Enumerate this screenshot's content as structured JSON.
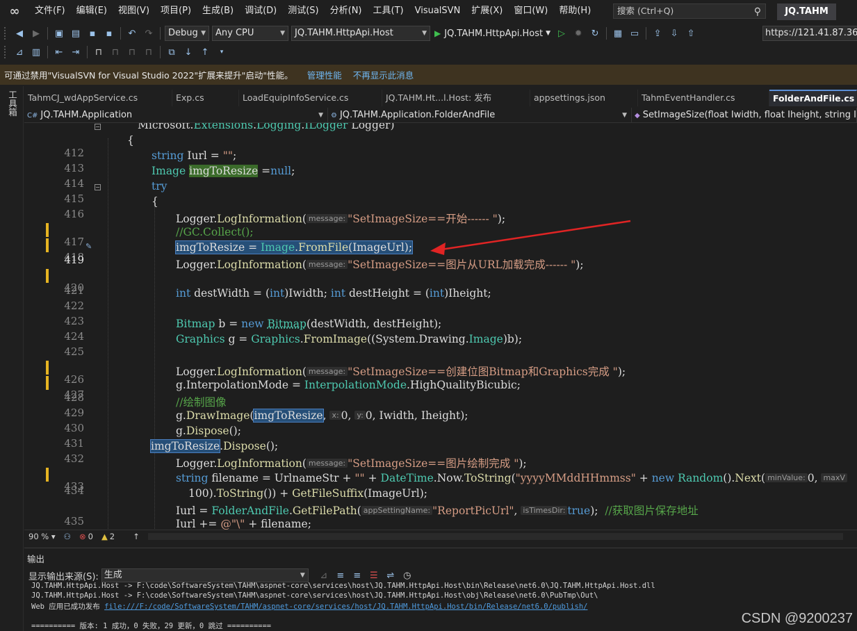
{
  "menu": {
    "items": [
      "文件(F)",
      "编辑(E)",
      "视图(V)",
      "项目(P)",
      "生成(B)",
      "调试(D)",
      "测试(S)",
      "分析(N)",
      "工具(T)",
      "VisualSVN",
      "扩展(X)",
      "窗口(W)",
      "帮助(H)"
    ],
    "search_placeholder": "搜索 (Ctrl+Q)",
    "solution_name": "JQ.TAHM"
  },
  "toolbar": {
    "configuration": "Debug",
    "platform": "Any CPU",
    "startup_project": "JQ.TAHM.HttpApi.Host",
    "run_target": "JQ.TAHM.HttpApi.Host",
    "url": "https://121.41.87.36/"
  },
  "infobar": {
    "message": "可通过禁用\"VisualSVN for Visual Studio 2022\"扩展来提升\"启动\"性能。",
    "link_manage": "管理性能",
    "link_dismiss": "不再显示此消息"
  },
  "left_strip": {
    "toolbox_label": "工具箱"
  },
  "tabs": [
    {
      "label": "TahmCJ_wdAppService.cs",
      "active": false
    },
    {
      "label": "Exp.cs",
      "active": false
    },
    {
      "label": "LoadEquipInfoService.cs",
      "active": false
    },
    {
      "label": "JQ.TAHM.Ht...l.Host: 发布",
      "active": false
    },
    {
      "label": "appsettings.json",
      "active": false
    },
    {
      "label": "TahmEventHandler.cs",
      "active": false
    },
    {
      "label": "FolderAndFile.cs",
      "active": true
    }
  ],
  "navbar": {
    "project": "JQ.TAHM.Application",
    "class": "JQ.TAHM.Application.FolderAndFile",
    "member": "SetImageSize(float Iwidth, float Iheight, string ImageUrl"
  },
  "editor": {
    "line_numbers": [
      "412",
      "413",
      "414",
      "415",
      "416",
      "417",
      "418",
      "419",
      "420",
      "421",
      "422",
      "423",
      "424",
      "425",
      "426",
      "427",
      "428",
      "429",
      "430",
      "431",
      "432",
      "433",
      "434",
      "",
      "435",
      "436"
    ],
    "current_line": "419",
    "hints": {
      "message": "message:",
      "x": "x:",
      "y": "y:",
      "minValue": "minValue:",
      "maxValue": "maxV",
      "appSettingName": "appSettingName:",
      "isTimesDir": "isTimesDir:"
    }
  },
  "status": {
    "zoom": "90 %",
    "errors": "0",
    "warnings": "2"
  },
  "output": {
    "title": "输出",
    "source_label": "显示输出来源(S):",
    "source_value": "生成",
    "lines": [
      "JQ.TAHM.HttpApi.Host -> F:\\code\\SoftwareSystem\\TAHM\\aspnet-core\\services\\host\\JQ.TAHM.HttpApi.Host\\bin\\Release\\net6.0\\JQ.TAHM.HttpApi.Host.dll",
      "JQ.TAHM.HttpApi.Host -> F:\\code\\SoftwareSystem\\TAHM\\aspnet-core\\services\\host\\JQ.TAHM.HttpApi.Host\\obj\\Release\\net6.0\\PubTmp\\Out\\"
    ],
    "publish_prefix": "Web 应用已成功发布 ",
    "publish_link": "file:///F:/code/SoftwareSystem/TAHM/aspnet-core/services/host/JQ.TAHM.HttpApi.Host/bin/Release/net6.0/publish/",
    "summary": "========== 版本: 1 成功，0 失败，29 更新，0 跳过 =========="
  },
  "watermark": "CSDN @9200237",
  "colors": {
    "keyword": "#569cd6",
    "type": "#4ec9b0",
    "method": "#dcdcaa",
    "string": "#d69d85",
    "comment": "#57a64a",
    "selection": "#264f78",
    "arrow": "#e02424",
    "change_marker": "#e6b422"
  }
}
